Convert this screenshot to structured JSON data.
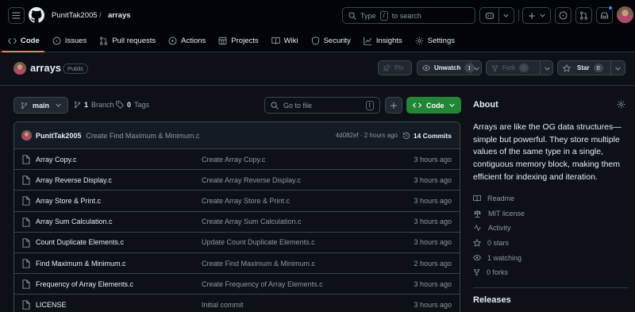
{
  "header": {
    "owner": "PunitTak2005",
    "separator": "/",
    "repo": "arrays",
    "search_prefix": "Type",
    "search_key": "/",
    "search_suffix": "to search"
  },
  "tabs": [
    {
      "label": "Code",
      "icon": "code-icon"
    },
    {
      "label": "Issues",
      "icon": "issue-icon"
    },
    {
      "label": "Pull requests",
      "icon": "pull-request-icon"
    },
    {
      "label": "Actions",
      "icon": "play-icon"
    },
    {
      "label": "Projects",
      "icon": "table-icon"
    },
    {
      "label": "Wiki",
      "icon": "book-icon"
    },
    {
      "label": "Security",
      "icon": "shield-icon"
    },
    {
      "label": "Insights",
      "icon": "graph-icon"
    },
    {
      "label": "Settings",
      "icon": "gear-icon"
    }
  ],
  "repo": {
    "name": "arrays",
    "visibility": "Public",
    "pin_label": "Pin",
    "unwatch_label": "Unwatch",
    "watch_count": "1",
    "fork_label": "Fork",
    "fork_count": "0",
    "star_label": "Star",
    "star_count": "0"
  },
  "controls": {
    "branch": "main",
    "branch_count": "1",
    "branch_label": "Branch",
    "tag_count": "0",
    "tag_label": "Tags",
    "goto_placeholder": "Go to file",
    "goto_key": "t",
    "code_label": "Code"
  },
  "commit": {
    "author": "PunitTak2005",
    "message": "Create Find Maximum & Minimum.c",
    "hash_time": "4d082ef · 2 hours ago",
    "commits_label": "14 Commits"
  },
  "files": [
    {
      "name": "Array Copy.c",
      "message": "Create Array Copy.c",
      "time": "3 hours ago"
    },
    {
      "name": "Array Reverse Display.c",
      "message": "Create Array Reverse Display.c",
      "time": "3 hours ago"
    },
    {
      "name": "Array Store & Print.c",
      "message": "Create Array Store & Print.c",
      "time": "3 hours ago"
    },
    {
      "name": "Array Sum Calculation.c",
      "message": "Create Array Sum Calculation.c",
      "time": "3 hours ago"
    },
    {
      "name": "Count Duplicate Elements.c",
      "message": "Update Count Duplicate Elements.c",
      "time": "3 hours ago"
    },
    {
      "name": "Find Maximum & Minimum.c",
      "message": "Create Find Maximum & Minimum.c",
      "time": "2 hours ago"
    },
    {
      "name": "Frequency of Array Elements.c",
      "message": "Create Frequency of Array Elements.c",
      "time": "3 hours ago"
    },
    {
      "name": "LICENSE",
      "message": "Initial commit",
      "time": "3 hours ago"
    }
  ],
  "about": {
    "title": "About",
    "description": "Arrays are like the OG data structures—simple but powerful. They store multiple values of the same type in a single, contiguous memory block, making them efficient for indexing and iteration.",
    "readme": "Readme",
    "license": "MIT license",
    "activity": "Activity",
    "stars": "0 stars",
    "watching": "1 watching",
    "forks": "0 forks",
    "releases": "Releases"
  },
  "colors": {
    "accent_green": "#238636",
    "tab_underline": "#f78166",
    "notification_dot": "#4493f8"
  }
}
